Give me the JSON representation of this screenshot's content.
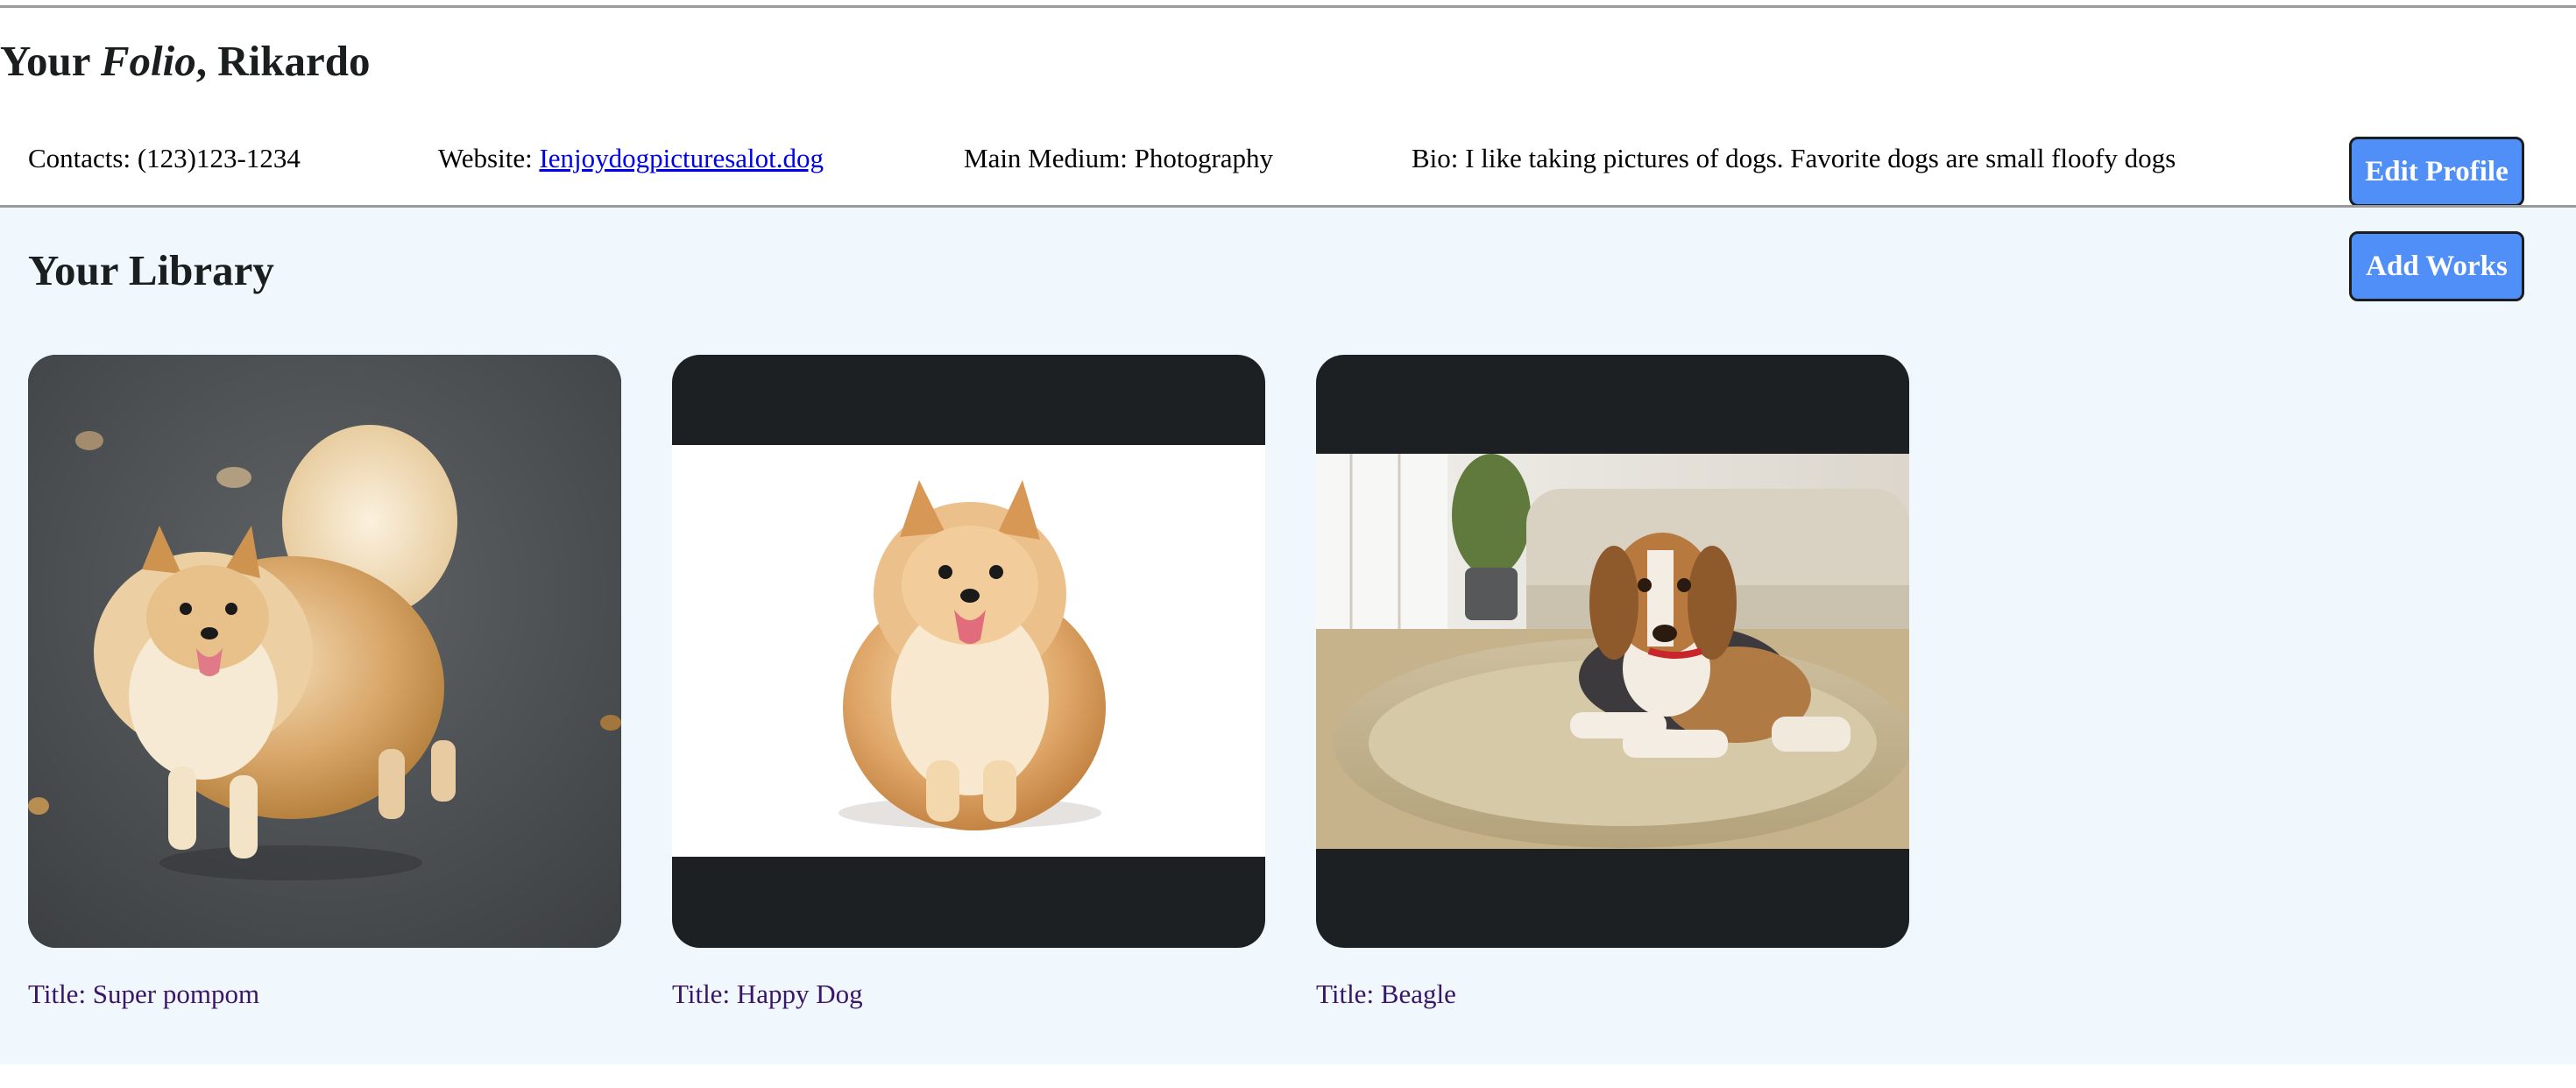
{
  "header": {
    "title_prefix": "Your ",
    "title_brand": "Folio",
    "title_suffix": ", Rikardo"
  },
  "profile": {
    "contacts_label": "Contacts: (123)123-1234",
    "website_prefix": "Website: ",
    "website_link": "Ienjoydogpicturesalot.dog",
    "medium_label": "Main Medium: Photography",
    "bio_label": "Bio: I like taking pictures of dogs. Favorite dogs are small floofy dogs",
    "edit_button": "Edit Profile"
  },
  "library": {
    "title": "Your Library",
    "add_button": "Add Works",
    "works": [
      {
        "title": "Title: Super pompom",
        "subject": "pomeranian-photo"
      },
      {
        "title": "Title: Happy Dog",
        "subject": "pomeranian-photo"
      },
      {
        "title": "Title: Beagle",
        "subject": "beagle-photo"
      }
    ]
  },
  "colors": {
    "button_bg": "#4f8ff7",
    "library_bg": "#f0f7fd",
    "card_bg": "#1c2022",
    "link": "#0000ee",
    "work_title": "#3a1569"
  }
}
